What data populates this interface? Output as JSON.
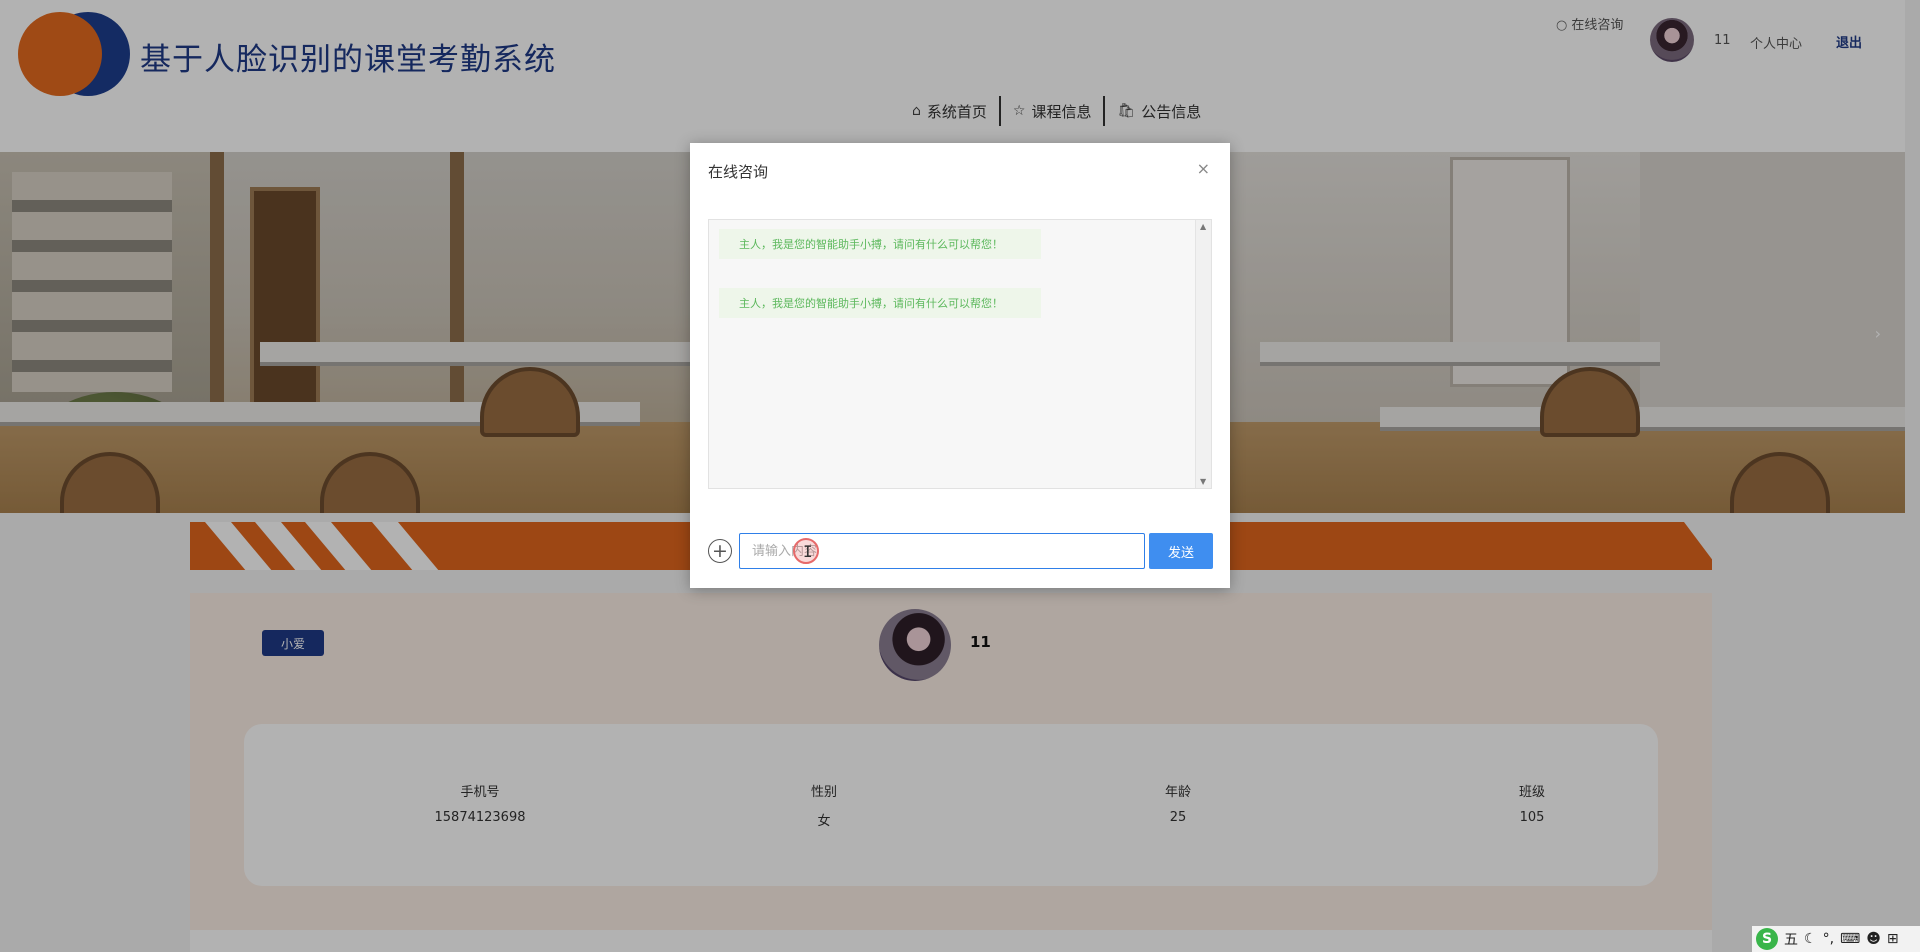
{
  "header": {
    "site_title": "基于人脸识别的课堂考勤系统",
    "consult_link": "在线咨询",
    "username": "11",
    "personal_center": "个人中心",
    "logout": "退出",
    "nav": [
      {
        "label": "系统首页",
        "icon": "home-icon"
      },
      {
        "label": "课程信息",
        "icon": "star-icon"
      },
      {
        "label": "公告信息",
        "icon": "bag-icon"
      }
    ]
  },
  "banner": {
    "next_arrow": "›"
  },
  "profile": {
    "tag": "小爱",
    "name": "11",
    "fields": [
      {
        "label": "手机号",
        "value": "15874123698"
      },
      {
        "label": "性别",
        "value": "女"
      },
      {
        "label": "年龄",
        "value": "25"
      },
      {
        "label": "班级",
        "value": "105"
      }
    ]
  },
  "modal": {
    "title": "在线咨询",
    "close": "×",
    "messages": [
      "主人，我是您的智能助手小搏，请问有什么可以帮您！",
      "主人，我是您的智能助手小搏，请问有什么可以帮您！"
    ],
    "input_placeholder": "请输入内容",
    "send_label": "发送"
  },
  "tray": {
    "ime": "S",
    "mode": "五",
    "icons": [
      "moon-icon",
      "punct-icon",
      "keyboard-icon",
      "user-icon",
      "grid-icon"
    ]
  }
}
